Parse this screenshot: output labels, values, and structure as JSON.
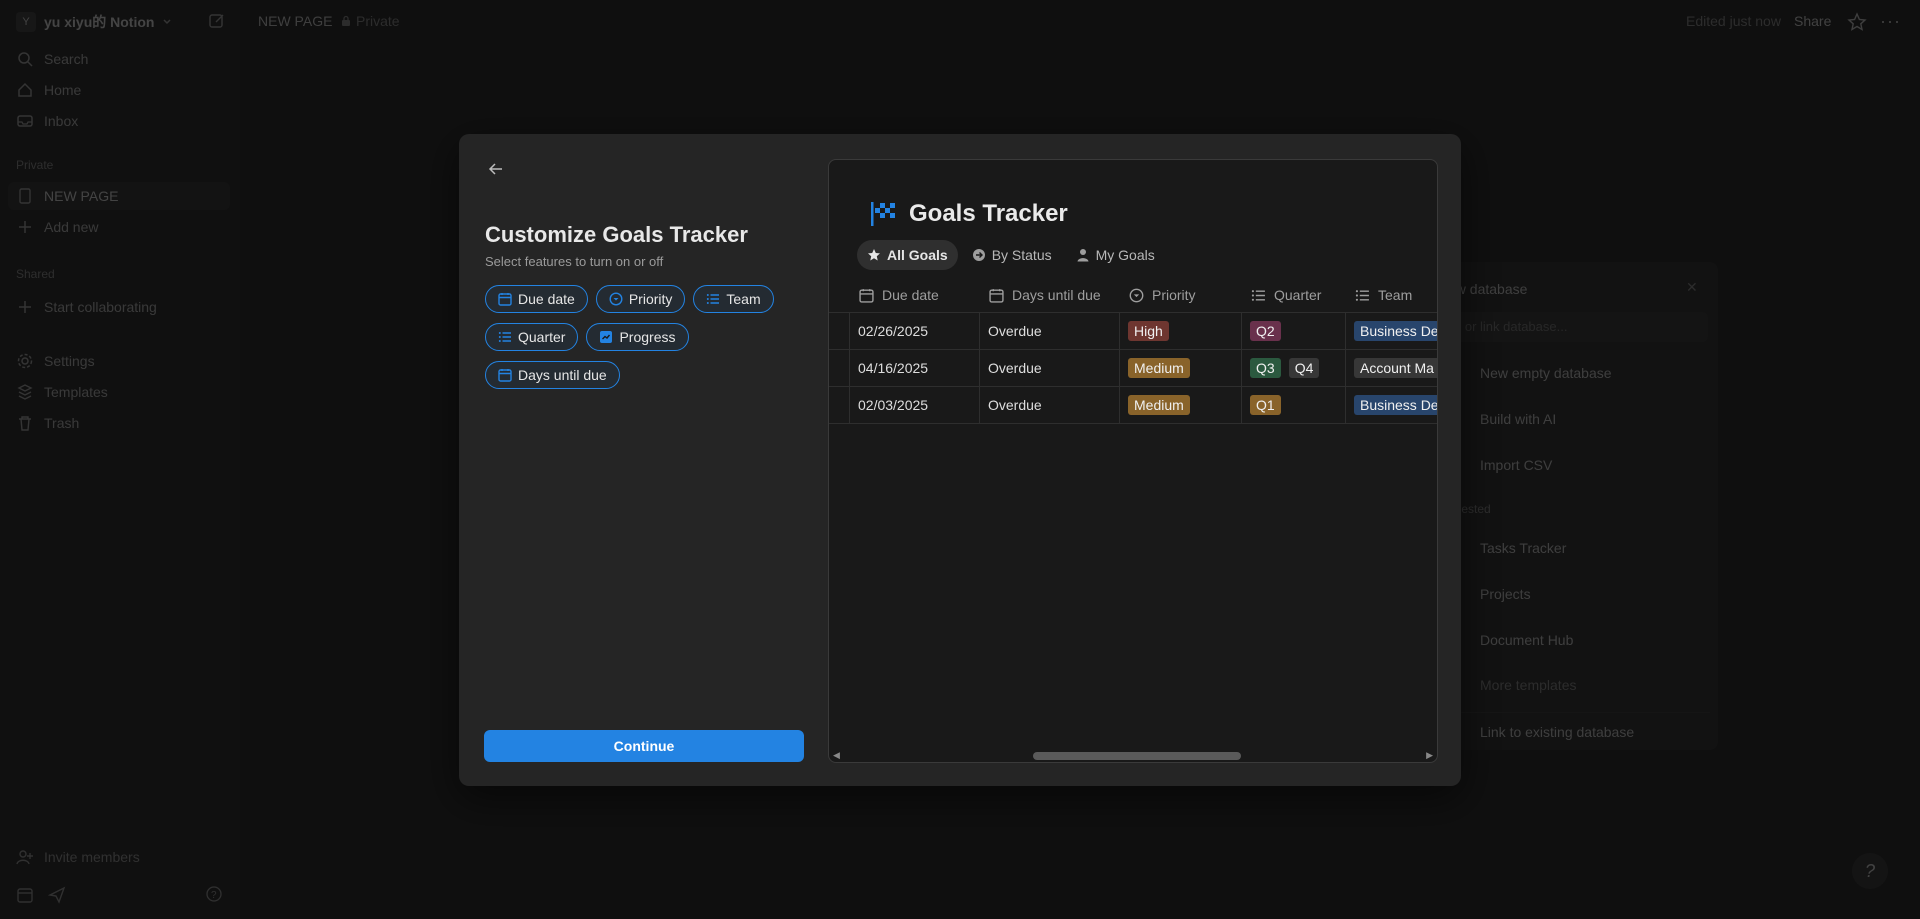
{
  "workspace": {
    "avatar": "Y",
    "name": "yu xiyu的 Notion"
  },
  "sidebar": {
    "nav": [
      {
        "label": "Search",
        "icon": "search-icon"
      },
      {
        "label": "Home",
        "icon": "home-icon"
      },
      {
        "label": "Inbox",
        "icon": "inbox-icon"
      }
    ],
    "private_label": "Private",
    "private_items": [
      {
        "label": "NEW PAGE",
        "icon": "page-icon"
      },
      {
        "label": "Add new",
        "icon": "plus-icon"
      }
    ],
    "shared_label": "Shared",
    "shared_items": [
      {
        "label": "Start collaborating",
        "icon": "plus-icon"
      }
    ],
    "bottom_items": [
      {
        "label": "Settings",
        "icon": "gear-icon"
      },
      {
        "label": "Templates",
        "icon": "templates-icon"
      },
      {
        "label": "Trash",
        "icon": "trash-icon"
      }
    ],
    "invite": "Invite members"
  },
  "topbar": {
    "page_title": "NEW PAGE",
    "privacy": "Private",
    "edited": "Edited just now",
    "share": "Share"
  },
  "new_database_panel": {
    "title": "ew database",
    "search_placeholder": "d or link database...",
    "items": [
      "New empty database",
      "Build with AI",
      "Import CSV"
    ],
    "suggested_label": "ggested",
    "suggested": [
      "Tasks Tracker",
      "Projects",
      "Document Hub",
      "More templates"
    ],
    "link_existing": "Link to existing database"
  },
  "modal": {
    "title": "Customize Goals Tracker",
    "subtitle": "Select features to turn on or off",
    "chips": [
      {
        "label": "Due date",
        "icon": "calendar-icon"
      },
      {
        "label": "Priority",
        "icon": "select-icon"
      },
      {
        "label": "Team",
        "icon": "list-icon"
      },
      {
        "label": "Quarter",
        "icon": "list-icon"
      },
      {
        "label": "Progress",
        "icon": "progress-icon"
      },
      {
        "label": "Days until due",
        "icon": "calendar-icon"
      }
    ],
    "continue": "Continue"
  },
  "preview": {
    "title": "Goals Tracker",
    "tabs": [
      {
        "label": "All Goals",
        "icon": "star-icon",
        "active": true
      },
      {
        "label": "By Status",
        "icon": "status-icon",
        "active": false
      },
      {
        "label": "My Goals",
        "icon": "person-icon",
        "active": false
      }
    ],
    "columns": [
      {
        "label": "Due date",
        "icon": "calendar-icon"
      },
      {
        "label": "Days until due",
        "icon": "calendar-icon"
      },
      {
        "label": "Priority",
        "icon": "select-icon"
      },
      {
        "label": "Quarter",
        "icon": "list-icon"
      },
      {
        "label": "Team",
        "icon": "list-icon"
      }
    ],
    "rows": [
      {
        "due": "02/26/2025",
        "days": "Overdue",
        "priority": "High",
        "quarters": [
          "Q2"
        ],
        "team": "Business Dev"
      },
      {
        "due": "04/16/2025",
        "days": "Overdue",
        "priority": "Medium",
        "quarters": [
          "Q3",
          "Q4"
        ],
        "team": "Account Ma"
      },
      {
        "due": "02/03/2025",
        "days": "Overdue",
        "priority": "Medium",
        "quarters": [
          "Q1"
        ],
        "team": "Business Dev"
      }
    ],
    "tag_colors": {
      "High": "#6e3630",
      "Medium": "#89632a",
      "Q1": "#89632a",
      "Q2": "#69314c",
      "Q3": "#2b593f",
      "Q4": "#373737",
      "Business Dev": "#28456c",
      "Account Ma": "#373737"
    }
  },
  "colors": {
    "accent": "#2383e2",
    "background": "#191919",
    "modal": "#252525"
  }
}
